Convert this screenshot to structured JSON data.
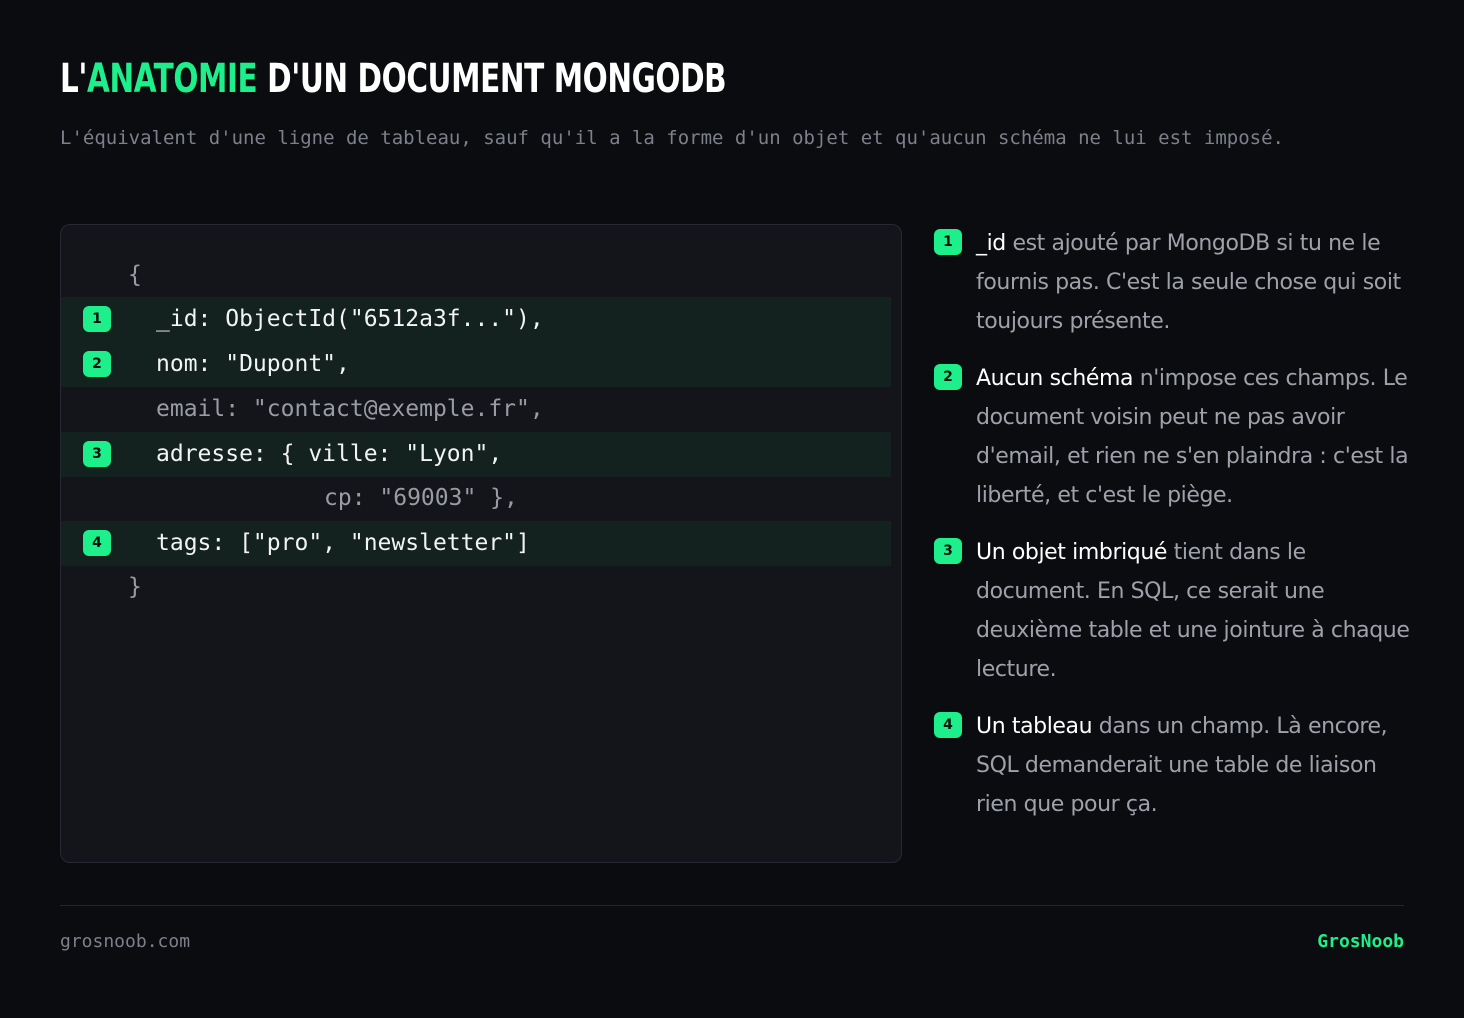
{
  "header": {
    "title_pre": "L'",
    "title_accent": "ANATOMIE",
    "title_post": " D'UN DOCUMENT MONGODB",
    "subtitle": "L'équivalent d'une ligne de tableau, sauf qu'il a la forme d'un objet et qu'aucun schéma ne lui est imposé."
  },
  "code": {
    "lines": [
      {
        "text": "{"
      },
      {
        "badge": "1",
        "text": "_id: ObjectId(\"6512a3f...\"),"
      },
      {
        "badge": "2",
        "text": "nom: \"Dupont\","
      },
      {
        "text": "email: \"contact@exemple.fr\","
      },
      {
        "badge": "3",
        "text": "adresse: { ville: \"Lyon\","
      },
      {
        "text": "cp: \"69003\" },"
      },
      {
        "badge": "4",
        "text": "tags: [\"pro\", \"newsletter\"]"
      },
      {
        "text": "}"
      }
    ]
  },
  "notes": [
    {
      "badge": "1",
      "strong": "_id",
      "text": " est ajouté par MongoDB si tu ne le fournis pas. C'est la seule chose qui soit toujours présente."
    },
    {
      "badge": "2",
      "strong": "Aucun schéma",
      "text": " n'impose ces champs. Le document voisin peut ne pas avoir d'email, et rien ne s'en plaindra : c'est la liberté, et c'est le piège."
    },
    {
      "badge": "3",
      "strong": "Un objet imbriqué",
      "text": " tient dans le document. En SQL, ce serait une deuxième table et une jointure à chaque lecture."
    },
    {
      "badge": "4",
      "strong": "Un tableau",
      "text": " dans un champ. Là encore, SQL demanderait une table de liaison rien que pour ça."
    }
  ],
  "footer": {
    "site": "grosnoob.com",
    "brand": "GrosNoob"
  },
  "colors": {
    "accent": "#1df08a",
    "background": "#0b0c10",
    "panel": "#13151b",
    "highlight_row": "#13221f"
  }
}
